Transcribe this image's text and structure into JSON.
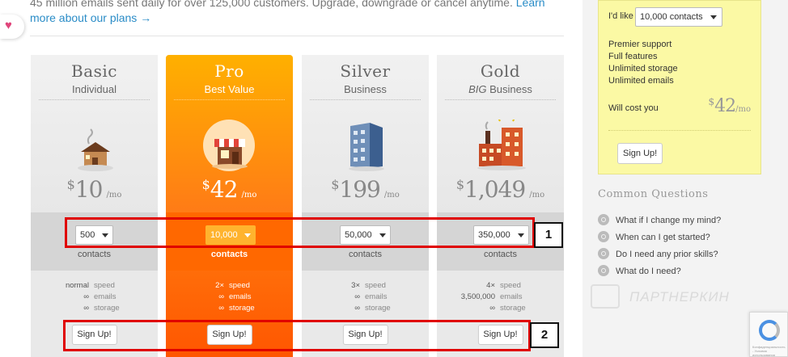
{
  "intro": {
    "text": "45 million emails sent daily for over 125,000 customers. Upgrade, downgrade or cancel anytime.",
    "link": "Learn more about our plans →"
  },
  "plans": [
    {
      "name": "Basic",
      "subtitle": "Individual",
      "currency": "$",
      "price": "10",
      "per": "/mo",
      "select_value": "500",
      "contacts_label": "contacts",
      "features": [
        {
          "value": "normal",
          "label": "speed"
        },
        {
          "value": "∞",
          "label": "emails"
        },
        {
          "value": "∞",
          "label": "storage"
        }
      ],
      "signup": "Sign Up!"
    },
    {
      "name": "Pro",
      "subtitle": "Best Value",
      "currency": "$",
      "price": "42",
      "per": "/mo",
      "select_value": "10,000",
      "contacts_label": "contacts",
      "features": [
        {
          "value": "2×",
          "label": "speed"
        },
        {
          "value": "∞",
          "label": "emails"
        },
        {
          "value": "∞",
          "label": "storage"
        }
      ],
      "signup": "Sign Up!"
    },
    {
      "name": "Silver",
      "subtitle": "Business",
      "currency": "$",
      "price": "199",
      "per": "/mo",
      "select_value": "50,000",
      "contacts_label": "contacts",
      "features": [
        {
          "value": "3×",
          "label": "speed"
        },
        {
          "value": "∞",
          "label": "emails"
        },
        {
          "value": "∞",
          "label": "storage"
        }
      ],
      "signup": "Sign Up!"
    },
    {
      "name": "Gold",
      "subtitle_em": "BIG",
      "subtitle": "Business",
      "currency": "$",
      "price": "1,049",
      "per": "/mo",
      "select_value": "350,000",
      "contacts_label": "contacts",
      "features": [
        {
          "value": "4×",
          "label": "speed"
        },
        {
          "value": "3,500,000",
          "label": "emails"
        },
        {
          "value": "∞",
          "label": "storage"
        }
      ],
      "signup": "Sign Up!"
    }
  ],
  "annotations": {
    "one": "1",
    "two": "2"
  },
  "calculator": {
    "like_label": "I'd like",
    "select_value": "10,000 contacts",
    "features": [
      "Premier support",
      "Full features",
      "Unlimited storage",
      "Unlimited emails"
    ],
    "cost_label": "Will cost you",
    "currency": "$",
    "price": "42",
    "per": "/mo",
    "signup": "Sign Up!"
  },
  "questions": {
    "title": "Common Questions",
    "items": [
      "What if I change my mind?",
      "When can I get started?",
      "Do I need any prior skills?",
      "What do I need?"
    ]
  },
  "watermark": {
    "text": "ПАРТНЕРКИН"
  },
  "recaptcha": {
    "text": "Конфиденциальность - Условия использования"
  },
  "colors": {
    "pro_accent": "#ff7b16",
    "annotation_red": "#e00000",
    "calculator_bg": "#fbf9a4",
    "link": "#2a8cc7"
  }
}
